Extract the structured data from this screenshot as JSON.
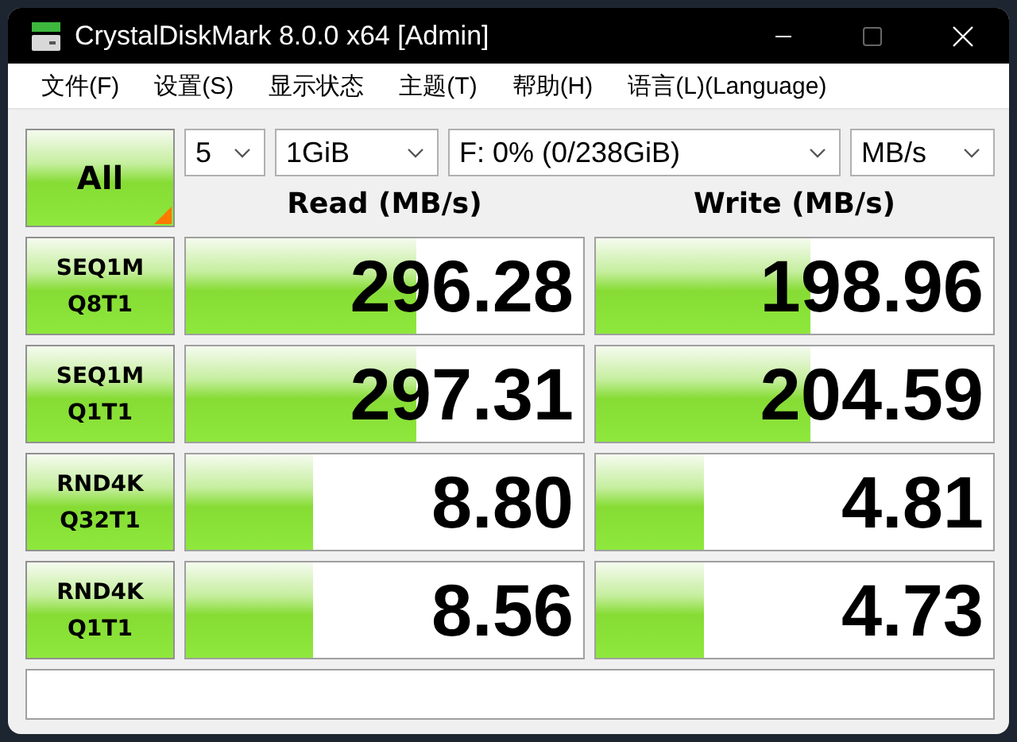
{
  "window": {
    "title": "CrystalDiskMark 8.0.0 x64 [Admin]"
  },
  "menu": [
    "文件(F)",
    "设置(S)",
    "显示状态",
    "主题(T)",
    "帮助(H)",
    "语言(L)(Language)"
  ],
  "all_button": {
    "label": "All"
  },
  "selects": [
    {
      "value": "5"
    },
    {
      "value": "1GiB"
    },
    {
      "value": "F: 0% (0/238GiB)"
    },
    {
      "value": "MB/s"
    }
  ],
  "columns": [
    "Read (MB/s)",
    "Write (MB/s)"
  ],
  "tests": [
    {
      "name": "SEQ1M",
      "params": "Q8T1",
      "read": {
        "value": "296.28",
        "level": 0.58
      },
      "write": {
        "value": "198.96",
        "level": 0.54
      }
    },
    {
      "name": "SEQ1M",
      "params": "Q1T1",
      "read": {
        "value": "297.31",
        "level": 0.58
      },
      "write": {
        "value": "204.59",
        "level": 0.54
      }
    },
    {
      "name": "RND4K",
      "params": "Q32T1",
      "read": {
        "value": "8.80",
        "level": 0.32
      },
      "write": {
        "value": "4.81",
        "level": 0.27
      }
    },
    {
      "name": "RND4K",
      "params": "Q1T1",
      "read": {
        "value": "8.56",
        "level": 0.32
      },
      "write": {
        "value": "4.73",
        "level": 0.27
      }
    }
  ]
}
